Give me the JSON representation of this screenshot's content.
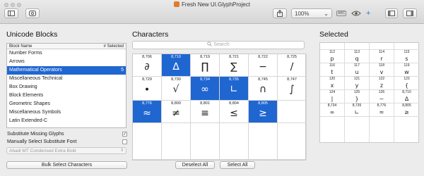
{
  "window": {
    "title": "Fresh New UI.GlyphProject"
  },
  "toolbar": {
    "zoom": "100%",
    "zoom_arrow": "⌄",
    "abc_label": "ABC",
    "plus": "+"
  },
  "left": {
    "heading": "Unicode Blocks",
    "col_name": "Block Name",
    "col_selected": "# Selected",
    "blocks": [
      {
        "name": "Number Forms",
        "count": ""
      },
      {
        "name": "Arrows",
        "count": ""
      },
      {
        "name": "Mathematical Operators",
        "count": "5"
      },
      {
        "name": "Miscellaneous Technical",
        "count": ""
      },
      {
        "name": "Box Drawing",
        "count": ""
      },
      {
        "name": "Block Elements",
        "count": ""
      },
      {
        "name": "Geometric Shapes",
        "count": ""
      },
      {
        "name": "Miscellaneous Symbols",
        "count": ""
      },
      {
        "name": "Latin Extended-C",
        "count": ""
      }
    ],
    "substitute_missing": "Substitute Missing Glyphs",
    "substitute_missing_checked": true,
    "manual_substitute": "Manually Select Substitute Font",
    "manual_substitute_checked": false,
    "font_popup": "Abadi MT Condensed Extra Bold",
    "bulk_button": "Bulk Select Characters"
  },
  "characters": {
    "heading": "Characters",
    "search_placeholder": "Search",
    "cells": [
      {
        "code": "8,706",
        "glyph": "∂",
        "selected": false
      },
      {
        "code": "8,710",
        "glyph": "∆",
        "selected": true
      },
      {
        "code": "8,719",
        "glyph": "∏",
        "selected": false
      },
      {
        "code": "8,721",
        "glyph": "∑",
        "selected": false
      },
      {
        "code": "8,722",
        "glyph": "−",
        "selected": false
      },
      {
        "code": "8,725",
        "glyph": "∕",
        "selected": false
      },
      {
        "code": "8,729",
        "glyph": "∙",
        "selected": false
      },
      {
        "code": "8,730",
        "glyph": "√",
        "selected": false
      },
      {
        "code": "8,734",
        "glyph": "∞",
        "selected": true
      },
      {
        "code": "8,735",
        "glyph": "∟",
        "selected": true
      },
      {
        "code": "8,745",
        "glyph": "∩",
        "selected": false
      },
      {
        "code": "8,747",
        "glyph": "∫",
        "selected": false
      },
      {
        "code": "8,776",
        "glyph": "≈",
        "selected": true
      },
      {
        "code": "8,800",
        "glyph": "≠",
        "selected": false
      },
      {
        "code": "8,801",
        "glyph": "≡",
        "selected": false
      },
      {
        "code": "8,804",
        "glyph": "≤",
        "selected": false
      },
      {
        "code": "8,805",
        "glyph": "≥",
        "selected": true
      },
      {
        "code": "",
        "glyph": "",
        "selected": false
      },
      {
        "code": "",
        "glyph": "",
        "selected": false
      },
      {
        "code": "",
        "glyph": "",
        "selected": false
      },
      {
        "code": "",
        "glyph": "",
        "selected": false
      },
      {
        "code": "",
        "glyph": "",
        "selected": false
      },
      {
        "code": "",
        "glyph": "",
        "selected": false
      },
      {
        "code": "",
        "glyph": "",
        "selected": false
      }
    ],
    "deselect_all": "Deselect All",
    "select_all": "Select All"
  },
  "selected": {
    "heading": "Selected",
    "cells": [
      {
        "code": "",
        "glyph": ""
      },
      {
        "code": "",
        "glyph": ""
      },
      {
        "code": "",
        "glyph": ""
      },
      {
        "code": "",
        "glyph": ""
      },
      {
        "code": "112",
        "glyph": "p"
      },
      {
        "code": "113",
        "glyph": "q"
      },
      {
        "code": "114",
        "glyph": "r"
      },
      {
        "code": "115",
        "glyph": "s"
      },
      {
        "code": "116",
        "glyph": "t"
      },
      {
        "code": "117",
        "glyph": "u"
      },
      {
        "code": "118",
        "glyph": "v"
      },
      {
        "code": "119",
        "glyph": "w"
      },
      {
        "code": "120",
        "glyph": "x"
      },
      {
        "code": "121",
        "glyph": "y"
      },
      {
        "code": "122",
        "glyph": "z"
      },
      {
        "code": "123",
        "glyph": "{"
      },
      {
        "code": "124",
        "glyph": "|"
      },
      {
        "code": "125",
        "glyph": "}"
      },
      {
        "code": "126",
        "glyph": "~"
      },
      {
        "code": "8,710",
        "glyph": "∆"
      },
      {
        "code": "8,734",
        "glyph": "∞"
      },
      {
        "code": "8,735",
        "glyph": "∟"
      },
      {
        "code": "8,776",
        "glyph": "≈"
      },
      {
        "code": "8,805",
        "glyph": "≥"
      },
      {
        "code": "",
        "glyph": ""
      },
      {
        "code": "",
        "glyph": ""
      },
      {
        "code": "",
        "glyph": ""
      },
      {
        "code": "",
        "glyph": ""
      }
    ]
  },
  "colors": {
    "accent": "#1f66d1",
    "file_icon": "#e07b2a"
  },
  "icons": [
    "sidebar-toggle-icon",
    "preview-icon",
    "share-icon",
    "abc-icon",
    "eye-icon",
    "add-icon",
    "left-panel-icon",
    "right-panel-icon",
    "file-icon",
    "checkmark-icon",
    "chevron-updown-icon",
    "search-icon"
  ]
}
